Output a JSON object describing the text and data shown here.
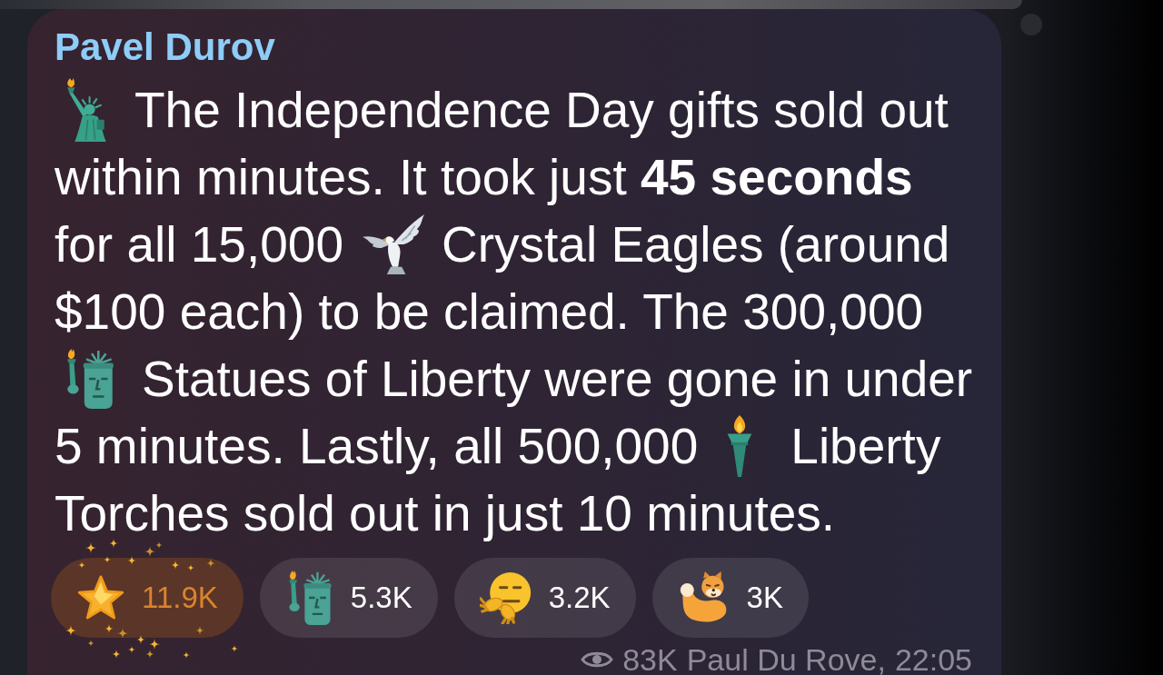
{
  "message": {
    "author": "Pavel Durov",
    "lines": [
      {
        "parts": [
          {
            "kind": "emoji"
          },
          {
            "kind": "text",
            "text": "The Independence Day gifts sold out"
          }
        ]
      },
      {
        "parts": [
          {
            "kind": "text",
            "text": "within minutes. It took just **45 seconds**"
          }
        ]
      },
      {
        "parts": [
          {
            "kind": "text",
            "text": "for all 15,000"
          },
          {
            "kind": "emoji"
          },
          {
            "kind": "text",
            "text": "Crystal Eagles (around"
          }
        ]
      },
      {
        "parts": [
          {
            "kind": "text",
            "text": "$100 each) to be claimed. The 300,000"
          }
        ]
      },
      {
        "parts": [
          {
            "kind": "emoji"
          },
          {
            "kind": "text",
            "text": "Statues of Liberty were gone in under"
          }
        ]
      },
      {
        "parts": [
          {
            "kind": "text",
            "text": "5 minutes. Lastly, all 500,000"
          },
          {
            "kind": "emoji"
          },
          {
            "kind": "text",
            "text": "Liberty"
          }
        ]
      },
      {
        "parts": [
          {
            "kind": "text",
            "text": "Torches sold out in just 10 minutes."
          }
        ]
      }
    ],
    "reactions": [
      {
        "count": "11.9K",
        "selected": true
      },
      {
        "count": "5.3K",
        "selected": false
      },
      {
        "count": "3.2K",
        "selected": false
      },
      {
        "count": "3K",
        "selected": false
      }
    ],
    "footer": {
      "views": "83K",
      "signature": "Paul Du Rove,",
      "time": "22:05"
    }
  }
}
